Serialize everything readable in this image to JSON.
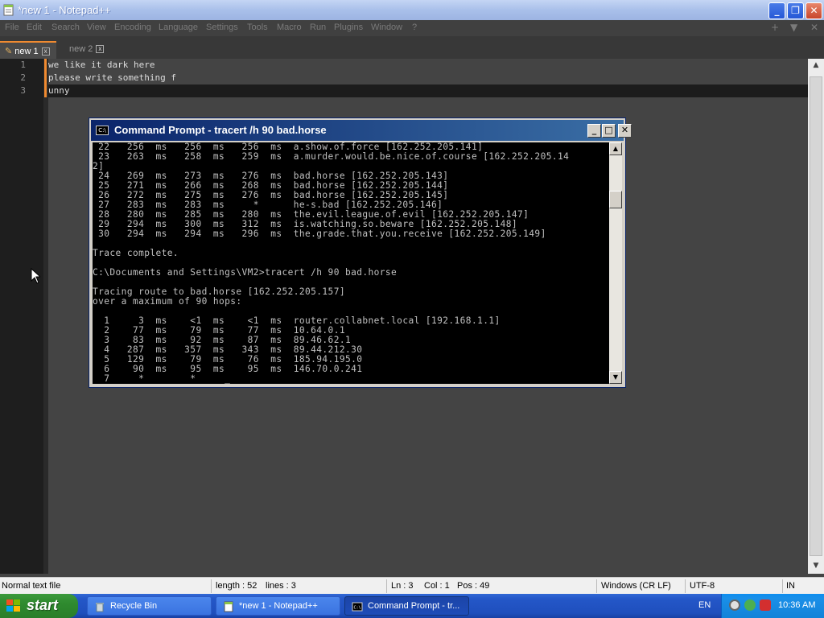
{
  "notepad": {
    "title": "*new 1 - Notepad++",
    "menu": [
      "File",
      "Edit",
      "Search",
      "View",
      "Encoding",
      "Language",
      "Settings",
      "Tools",
      "Macro",
      "Run",
      "Plugins",
      "Window",
      "?"
    ],
    "menu_right": [
      "+",
      "▼",
      "✕"
    ],
    "tabs": [
      {
        "label": "new 1",
        "close": "x"
      },
      {
        "label": "new 2",
        "close": "x"
      }
    ],
    "line_numbers": [
      "1",
      "2",
      "3"
    ],
    "lines": [
      "we like it dark here",
      "please write something f",
      "unny"
    ],
    "status": {
      "file_type": "Normal text file",
      "length": "length : 52",
      "lines": "lines : 3",
      "ln": "Ln : 3",
      "col": "Col : 1",
      "pos": "Pos : 49",
      "eol": "Windows (CR LF)",
      "encoding": "UTF-8",
      "mode": "IN"
    }
  },
  "cmd": {
    "title": "Command Prompt - tracert /h 90 bad.horse",
    "lines": [
      " 22   256  ms   256  ms   256  ms  a.show.of.force [162.252.205.141]",
      " 23   263  ms   258  ms   259  ms  a.murder.would.be.nice.of.course [162.252.205.14",
      "2]",
      " 24   269  ms   273  ms   276  ms  bad.horse [162.252.205.143]",
      " 25   271  ms   266  ms   268  ms  bad.horse [162.252.205.144]",
      " 26   272  ms   275  ms   276  ms  bad.horse [162.252.205.145]",
      " 27   283  ms   283  ms     *      he-s.bad [162.252.205.146]",
      " 28   280  ms   285  ms   280  ms  the.evil.league.of.evil [162.252.205.147]",
      " 29   294  ms   300  ms   312  ms  is.watching.so.beware [162.252.205.148]",
      " 30   294  ms   294  ms   296  ms  the.grade.that.you.receive [162.252.205.149]",
      "",
      "Trace complete.",
      "",
      "C:\\Documents and Settings\\VM2>tracert /h 90 bad.horse",
      "",
      "Tracing route to bad.horse [162.252.205.157]",
      "over a maximum of 90 hops:",
      "",
      "  1     3  ms    <1  ms    <1  ms  router.collabnet.local [192.168.1.1]",
      "  2    77  ms    79  ms    77  ms  10.64.0.1",
      "  3    83  ms    92  ms    87  ms  89.46.62.1",
      "  4   287  ms   357  ms   343  ms  89.44.212.30",
      "  5   129  ms    79  ms    76  ms  185.94.195.0",
      "  6    90  ms    95  ms    95  ms  146.70.0.241",
      "  7     *        *     _"
    ]
  },
  "taskbar": {
    "start_label": "start",
    "items": [
      {
        "label": "Recycle Bin"
      },
      {
        "label": "*new 1 - Notepad++"
      },
      {
        "label": "Command Prompt - tr..."
      }
    ],
    "language": "EN",
    "time": "10:36 AM"
  },
  "colors": {
    "notepad_bg": "#444444",
    "gutter_bg": "#1e1e1e",
    "change_marker": "#f08a30",
    "console_bg": "#000000",
    "console_text": "#c0c0c0",
    "taskbar": "#245edb",
    "start_green": "#2e8a2e"
  }
}
